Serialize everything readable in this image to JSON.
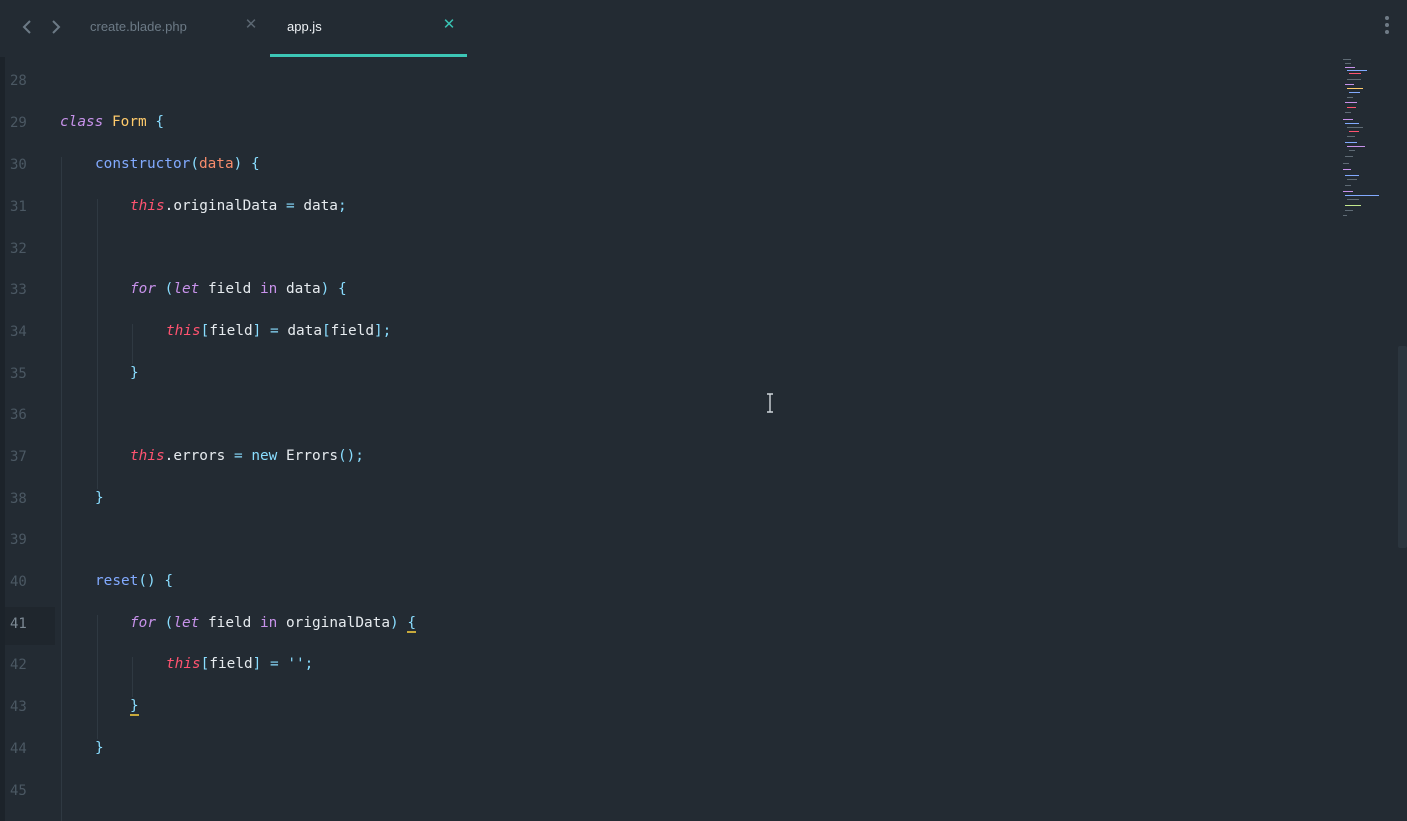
{
  "tabs": [
    {
      "label": "create.blade.php",
      "active": false
    },
    {
      "label": "app.js",
      "active": true
    }
  ],
  "nav": {
    "back_icon": "chevron-left-icon",
    "forward_icon": "chevron-right-icon"
  },
  "menu_icon": "vertical-ellipsis-icon",
  "editor": {
    "current_line": 41,
    "lines": [
      {
        "n": "28"
      },
      {
        "n": "29"
      },
      {
        "n": "30"
      },
      {
        "n": "31"
      },
      {
        "n": "32"
      },
      {
        "n": "33"
      },
      {
        "n": "34"
      },
      {
        "n": "35"
      },
      {
        "n": "36"
      },
      {
        "n": "37"
      },
      {
        "n": "38"
      },
      {
        "n": "39"
      },
      {
        "n": "40"
      },
      {
        "n": "41"
      },
      {
        "n": "42"
      },
      {
        "n": "43"
      },
      {
        "n": "44"
      },
      {
        "n": "45"
      }
    ],
    "code": {
      "l29": [
        "class",
        "Form",
        "{"
      ],
      "l30": [
        "constructor",
        "(",
        "data",
        ")",
        "{"
      ],
      "l31": [
        "this",
        ".originalData",
        "=",
        "data",
        ";"
      ],
      "l33": [
        "for",
        "(",
        "let",
        "field",
        "in",
        "data",
        ")",
        "{"
      ],
      "l34": [
        "this",
        "[",
        "field",
        "]",
        "=",
        "data",
        "[",
        "field",
        "];"
      ],
      "l35": [
        "}"
      ],
      "l37": [
        "this",
        ".errors",
        "=",
        "new",
        "Errors",
        "();"
      ],
      "l38": [
        "}"
      ],
      "l40": [
        "reset",
        "()",
        "{"
      ],
      "l41": [
        "for",
        "(",
        "let",
        "field",
        "in",
        "originalData",
        ")",
        "{"
      ],
      "l42": [
        "this",
        "[",
        "field",
        "]",
        "=",
        "''",
        ";"
      ],
      "l43": [
        "}"
      ],
      "l44": [
        "}"
      ]
    }
  },
  "colors": {
    "background": "#232b33",
    "accent": "#3cc6b6",
    "keyword": "#c792ea",
    "class": "#ffcb6b",
    "function": "#82aaff",
    "this": "#ff5370",
    "parameter": "#f78c6c",
    "punctuation": "#89ddff"
  }
}
